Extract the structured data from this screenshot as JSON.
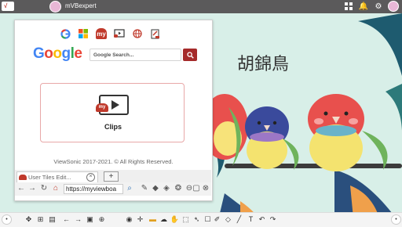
{
  "topbar": {
    "logo_text": "√",
    "username": "mVBexpert",
    "icons": [
      "apps-icon",
      "bell-icon",
      "settings-icon",
      "user-avatar"
    ]
  },
  "artwork": {
    "title": "胡錦鳥"
  },
  "browser": {
    "quick_links": [
      "google-link",
      "microsoft-link",
      "myviewboard-link",
      "clips-link",
      "globe-link",
      "whiteboard-link"
    ],
    "google_logo": [
      "G",
      "o",
      "o",
      "g",
      "l",
      "e"
    ],
    "search_placeholder": "Google Search...",
    "clips": {
      "badge": "my",
      "label": "Clips"
    },
    "footer": "ViewSonic 2017-2021. © All Rights Reserved.",
    "tab_label": "User Tiles Edit...",
    "new_tab": "+",
    "url": "https://myviewboa"
  },
  "colors": {
    "accent": "#a52a2a",
    "topbar": "#5b5a5b",
    "background": "#d8efe8"
  }
}
